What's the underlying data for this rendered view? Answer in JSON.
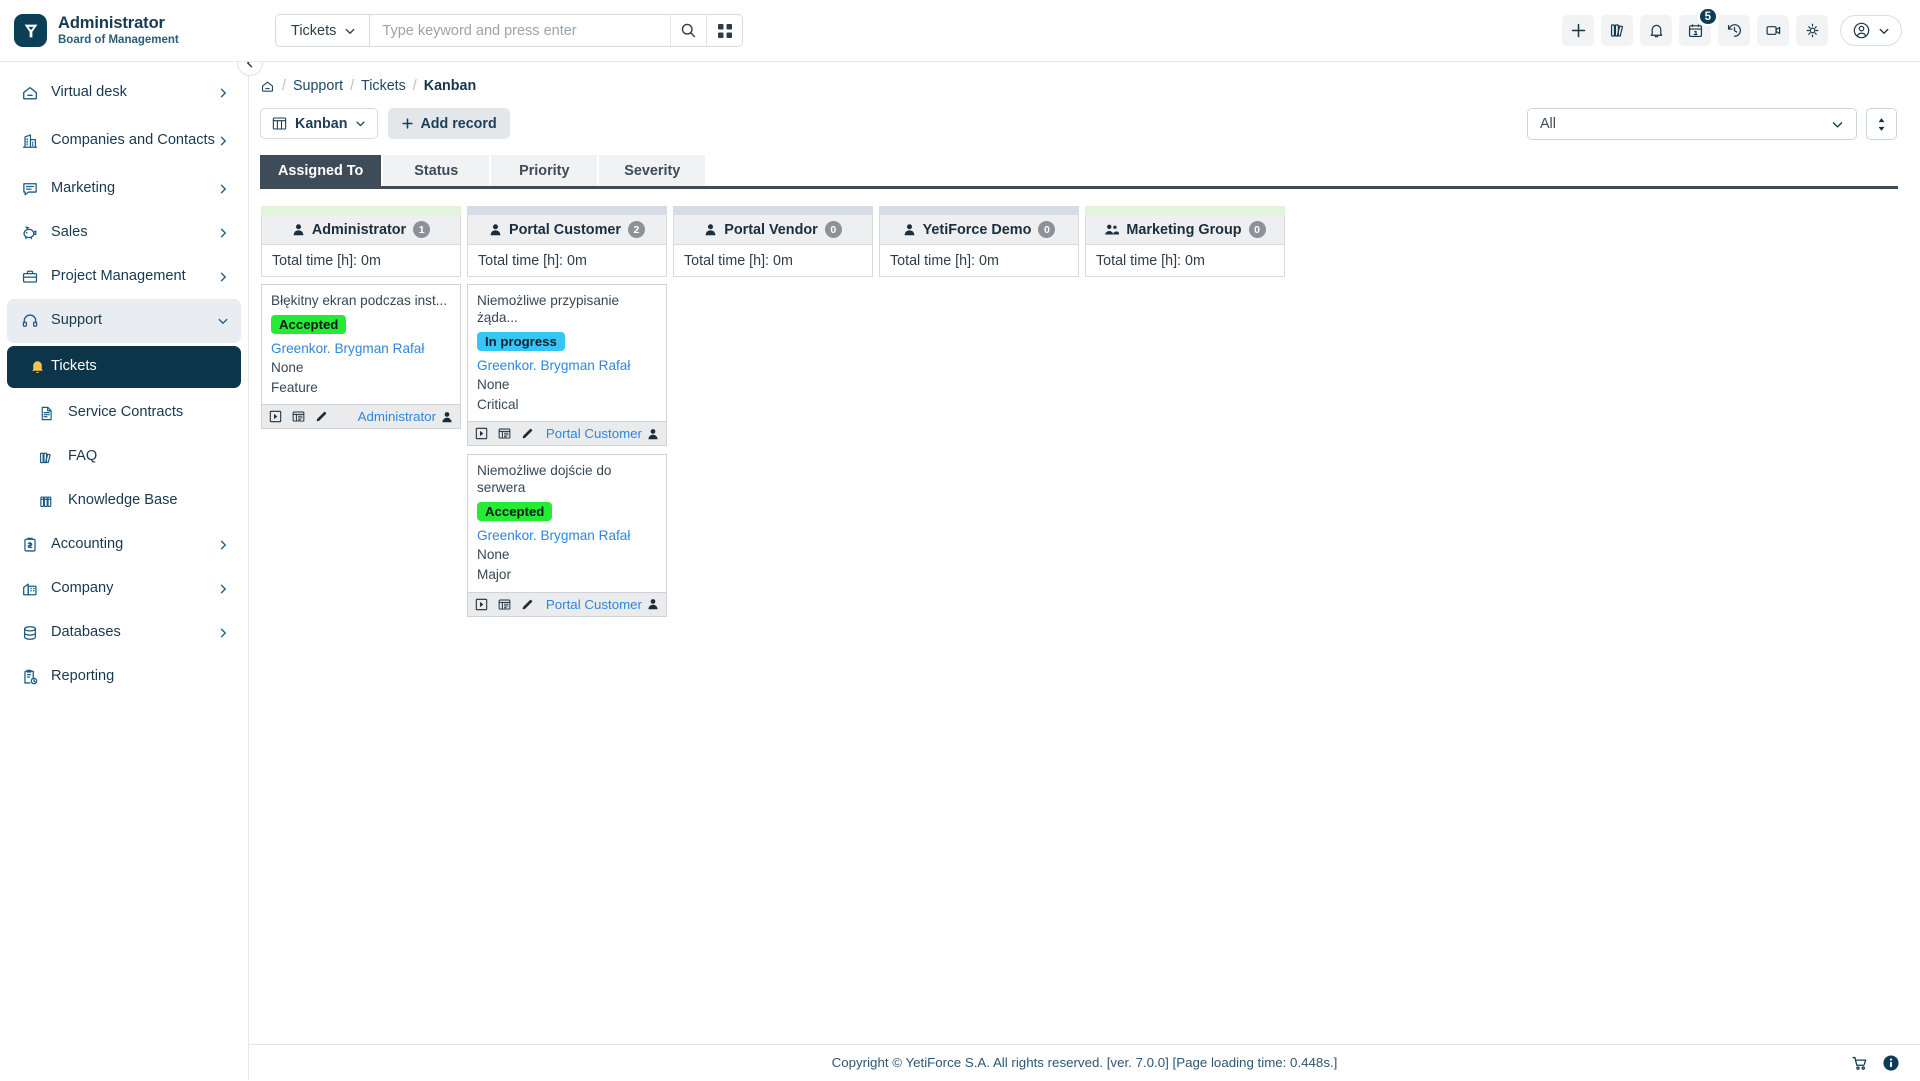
{
  "brand": {
    "logo_icon": "yetiforce-logo-icon",
    "title": "Administrator",
    "subtitle": "Board of Management"
  },
  "search": {
    "scope_label": "Tickets",
    "scope_chevron_icon": "chevron-down-icon",
    "placeholder": "Type keyword and press enter",
    "value": "",
    "search_icon": "search-icon",
    "grid_icon": "grid-apps-icon"
  },
  "topbar_icons": [
    {
      "name": "add-icon",
      "glyph": "plus"
    },
    {
      "name": "library-icon",
      "glyph": "books"
    },
    {
      "name": "notifications-bell-icon",
      "glyph": "bell"
    },
    {
      "name": "calendar-icon",
      "glyph": "calendar",
      "badge": "5"
    },
    {
      "name": "history-icon",
      "glyph": "history"
    },
    {
      "name": "video-call-icon",
      "glyph": "video"
    },
    {
      "name": "settings-gear-icon",
      "glyph": "gear"
    }
  ],
  "user_menu": {
    "avatar_icon": "user-circle-icon",
    "chevron_icon": "chevron-down-icon"
  },
  "sidebar": {
    "collapse_icon": "chevron-left-icon",
    "items": [
      {
        "label": "Virtual desk",
        "icon": "home-icon",
        "chevron": "right",
        "state": "normal"
      },
      {
        "label": "Companies and Contacts",
        "icon": "building-icon",
        "chevron": "right",
        "state": "normal"
      },
      {
        "label": "Marketing",
        "icon": "chat-icon",
        "chevron": "right",
        "state": "normal"
      },
      {
        "label": "Sales",
        "icon": "piggy-bank-icon",
        "chevron": "right",
        "state": "normal"
      },
      {
        "label": "Project Management",
        "icon": "briefcase-icon",
        "chevron": "right",
        "state": "normal"
      },
      {
        "label": "Support",
        "icon": "headset-icon",
        "chevron": "down",
        "state": "open"
      },
      {
        "label": "Tickets",
        "icon": "bell-icon",
        "chevron": "none",
        "state": "active"
      },
      {
        "label": "Service Contracts",
        "icon": "document-icon",
        "chevron": "none",
        "state": "sub"
      },
      {
        "label": "FAQ",
        "icon": "books-icon",
        "chevron": "none",
        "state": "sub"
      },
      {
        "label": "Knowledge Base",
        "icon": "books-alt-icon",
        "chevron": "none",
        "state": "sub"
      },
      {
        "label": "Accounting",
        "icon": "invoice-icon",
        "chevron": "right",
        "state": "normal"
      },
      {
        "label": "Company",
        "icon": "company-icon",
        "chevron": "right",
        "state": "normal"
      },
      {
        "label": "Databases",
        "icon": "database-icon",
        "chevron": "right",
        "state": "normal"
      },
      {
        "label": "Reporting",
        "icon": "report-icon",
        "chevron": "none",
        "state": "normal"
      }
    ]
  },
  "breadcrumb": {
    "home_icon": "home-icon",
    "items": [
      "Support",
      "Tickets"
    ],
    "current": "Kanban",
    "separator": "/"
  },
  "toolbar": {
    "view_icon": "kanban-board-icon",
    "view_label": "Kanban",
    "view_chevron_icon": "chevron-down-icon",
    "add_record_label": "Add record",
    "add_record_icon": "plus-icon",
    "filter_value": "All",
    "filter_chevron_icon": "chevron-down-icon",
    "sort_icon": "sort-updown-icon"
  },
  "tabs": [
    {
      "label": "Assigned To",
      "active": true
    },
    {
      "label": "Status",
      "active": false
    },
    {
      "label": "Priority",
      "active": false
    },
    {
      "label": "Severity",
      "active": false
    }
  ],
  "colors": {
    "strip_green": "#e0f5da",
    "strip_blue": "#d6dce7",
    "badge_accepted_bg": "#24ec35",
    "badge_accepted_fg": "#0e1b14",
    "badge_inprogress_bg": "#35c6f4",
    "badge_inprogress_fg": "#102233",
    "link_blue": "#2f86db",
    "sidebar_active_bg": "#0c3549",
    "tab_active_bg": "#3e4b58"
  },
  "kanban": {
    "total_time_label": "Total time [h]: 0m",
    "columns": [
      {
        "title": "Administrator",
        "count": "1",
        "icon": "user-icon",
        "strip": "green",
        "total_time": "Total time [h]: 0m",
        "cards": [
          {
            "title": "Błękitny ekran podczas inst...",
            "status": "Accepted",
            "status_style": "accepted",
            "person": "Greenkor. Brygman Rafał",
            "line1": "None",
            "line2": "Feature",
            "assignee": "Administrator",
            "footer_icons": [
              "play-box-icon",
              "list-view-icon",
              "edit-pencil-icon"
            ],
            "assignee_icon": "user-icon"
          }
        ]
      },
      {
        "title": "Portal Customer",
        "count": "2",
        "icon": "user-icon",
        "strip": "blue",
        "total_time": "Total time [h]: 0m",
        "cards": [
          {
            "title": "Niemożliwe przypisanie żąda...",
            "status": "In progress",
            "status_style": "inprogress",
            "person": "Greenkor. Brygman Rafał",
            "line1": "None",
            "line2": "Critical",
            "assignee": "Portal Customer",
            "footer_icons": [
              "play-box-icon",
              "list-view-icon",
              "edit-pencil-icon"
            ],
            "assignee_icon": "user-icon"
          },
          {
            "title": "Niemożliwe dojście do serwera",
            "status": "Accepted",
            "status_style": "accepted",
            "person": "Greenkor. Brygman Rafał",
            "line1": "None",
            "line2": "Major",
            "assignee": "Portal Customer",
            "footer_icons": [
              "play-box-icon",
              "list-view-icon",
              "edit-pencil-icon"
            ],
            "assignee_icon": "user-icon"
          }
        ]
      },
      {
        "title": "Portal Vendor",
        "count": "0",
        "icon": "user-icon",
        "strip": "blue",
        "total_time": "Total time [h]: 0m",
        "cards": []
      },
      {
        "title": "YetiForce Demo",
        "count": "0",
        "icon": "user-icon",
        "strip": "blue",
        "total_time": "Total time [h]: 0m",
        "cards": []
      },
      {
        "title": "Marketing Group",
        "count": "0",
        "icon": "group-icon",
        "strip": "green",
        "total_time": "Total time [h]: 0m",
        "cards": []
      }
    ]
  },
  "footer": {
    "text": "Copyright © YetiForce S.A. All rights reserved. [ver. 7.0.0] [Page loading time: 0.448s.]",
    "cart_icon": "shopping-cart-icon",
    "info_icon": "info-circle-icon"
  }
}
